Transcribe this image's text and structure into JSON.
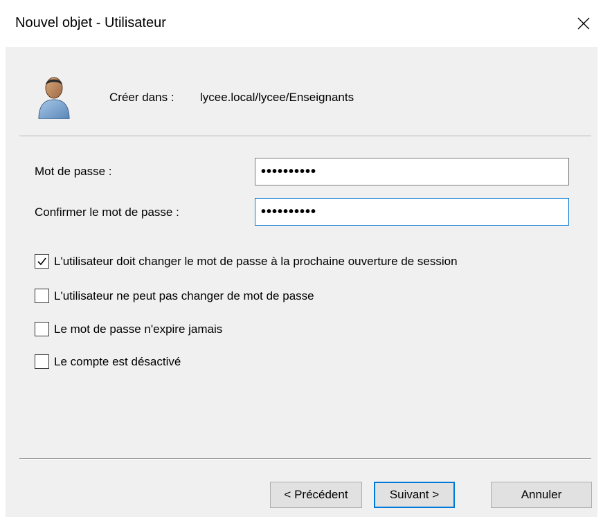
{
  "window": {
    "title": "Nouvel objet - Utilisateur",
    "close_icon": "close-icon"
  },
  "header": {
    "icon": "user-icon",
    "create_in_label": "Créer dans :",
    "create_in_path": "lycee.local/lycee/Enseignants"
  },
  "form": {
    "password_label": "Mot de passe :",
    "password_value": "••••••••••",
    "confirm_label": "Confirmer le mot de passe :",
    "confirm_value": "••••••••••"
  },
  "options": [
    {
      "label": "L'utilisateur doit changer le mot de passe à la prochaine ouverture de session",
      "checked": true
    },
    {
      "label": "L'utilisateur ne peut pas changer de mot de passe",
      "checked": false
    },
    {
      "label": "Le mot de passe n'expire jamais",
      "checked": false
    },
    {
      "label": "Le compte est désactivé",
      "checked": false
    }
  ],
  "buttons": {
    "back": "< Précédent",
    "next": "Suivant >",
    "cancel": "Annuler"
  },
  "colors": {
    "accent": "#0078d7",
    "dialog_bg": "#f0f0f0"
  }
}
